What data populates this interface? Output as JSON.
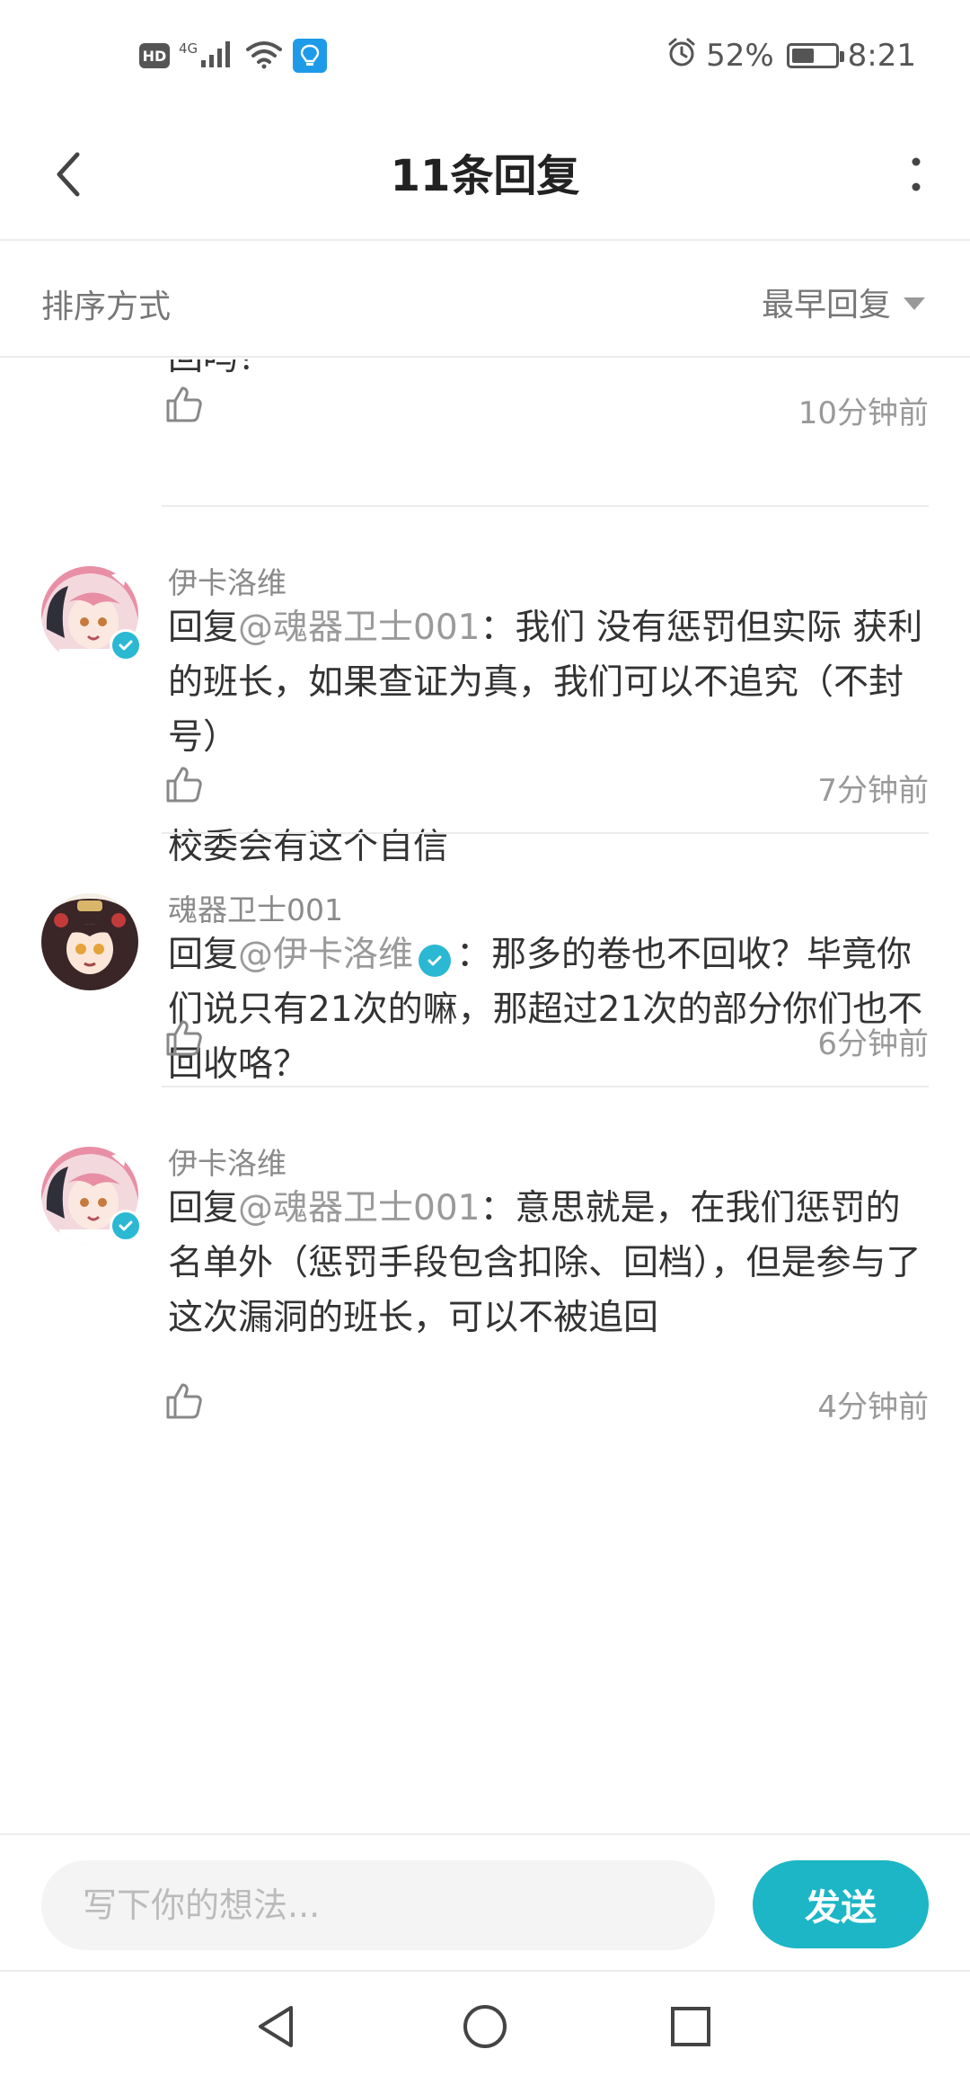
{
  "status_bar": {
    "hd_label": "HD",
    "network_label": "4G",
    "battery_percent_label": "52%",
    "battery_level": 0.52,
    "time": "8:21"
  },
  "header": {
    "title": "11条回复"
  },
  "sort": {
    "label": "排序方式",
    "selected": "最早回复"
  },
  "replies": [
    {
      "body": "回吗？",
      "time": "10分钟前"
    },
    {
      "author": "伊卡洛维",
      "reply_prefix": "回复",
      "mention": "@魂器卫士001",
      "body": "：我们 没有惩罚但实际 获利的班长，如果查证为真，我们可以不追究（不封号）\n\n校委会有这个自信",
      "time": "7分钟前",
      "avatar_icon": "avatar-anime-pink-hair",
      "verified": true
    },
    {
      "author": "魂器卫士001",
      "reply_prefix": "回复",
      "mention": "@伊卡洛维",
      "body": "：那多的卷也不回收？毕竟你们说只有21次的嘛，那超过21次的部分你们也不回收咯？",
      "time": "6分钟前",
      "avatar_icon": "avatar-anime-dark-hair",
      "verified": false
    },
    {
      "author": "伊卡洛维",
      "reply_prefix": "回复",
      "mention": "@魂器卫士001",
      "body": "：意思就是，在我们惩罚的名单外（惩罚手段包含扣除、回档），但是参与了这次漏洞的班长，可以不被追回",
      "time": "4分钟前",
      "avatar_icon": "avatar-anime-pink-hair",
      "verified": true
    }
  ],
  "composer": {
    "placeholder": "写下你的想法...",
    "send_label": "发送"
  },
  "colors": {
    "accent": "#1cb6c6",
    "verified": "#2ab8d3",
    "muted_text": "#999999"
  }
}
